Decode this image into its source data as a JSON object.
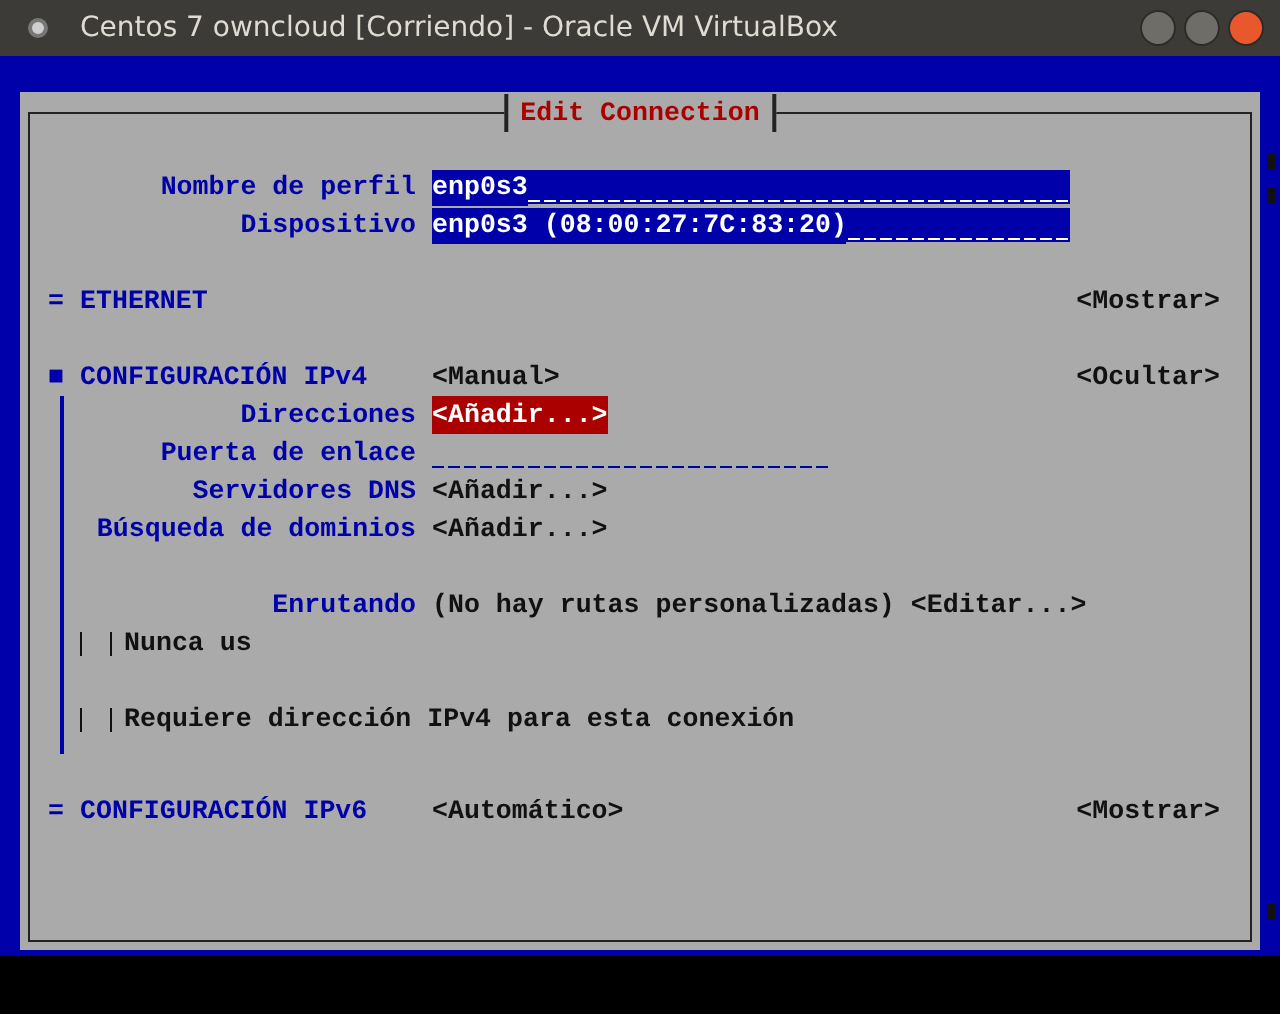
{
  "window": {
    "title": "Centos 7 owncloud [Corriendo] - Oracle VM VirtualBox"
  },
  "dialog": {
    "title": "Edit Connection"
  },
  "profile_fields": [
    {
      "label": "Nombre de perfil",
      "value": "enp0s3"
    },
    {
      "label": "Dispositivo",
      "value": "enp0s3 (08:00:27:7C:83:20)"
    }
  ],
  "sections": [
    {
      "marker": "=",
      "title": "ETHERNET",
      "toggle": "<Mostrar>"
    },
    {
      "marker": "■",
      "title": "CONFIGURACIÓN IPv4",
      "value": "<Manual>",
      "toggle": "<Ocultar>",
      "rows": [
        {
          "kind": "button",
          "label": "Direcciones",
          "value": "<Añadir...>",
          "selected": true
        },
        {
          "kind": "field",
          "label": "Puerta de enlace"
        },
        {
          "kind": "button",
          "label": "Servidores DNS",
          "value": "<Añadir...>",
          "selected": false
        },
        {
          "kind": "button",
          "label": "Búsqueda de dominios",
          "value": "<Añadir...>",
          "selected": false
        },
        {
          "kind": "routes",
          "label": "Enrutando",
          "note": "(No hay rutas personalizadas)",
          "value": "<Editar...>"
        },
        {
          "kind": "checkbox",
          "text": "Nunca us",
          "checked": false
        },
        {
          "kind": "checkbox",
          "text": "Requiere dirección IPv4 para esta conexión",
          "checked": false
        }
      ]
    },
    {
      "marker": "=",
      "title": "CONFIGURACIÓN IPv6",
      "value": "<Automático>",
      "toggle": "<Mostrar>"
    }
  ]
}
